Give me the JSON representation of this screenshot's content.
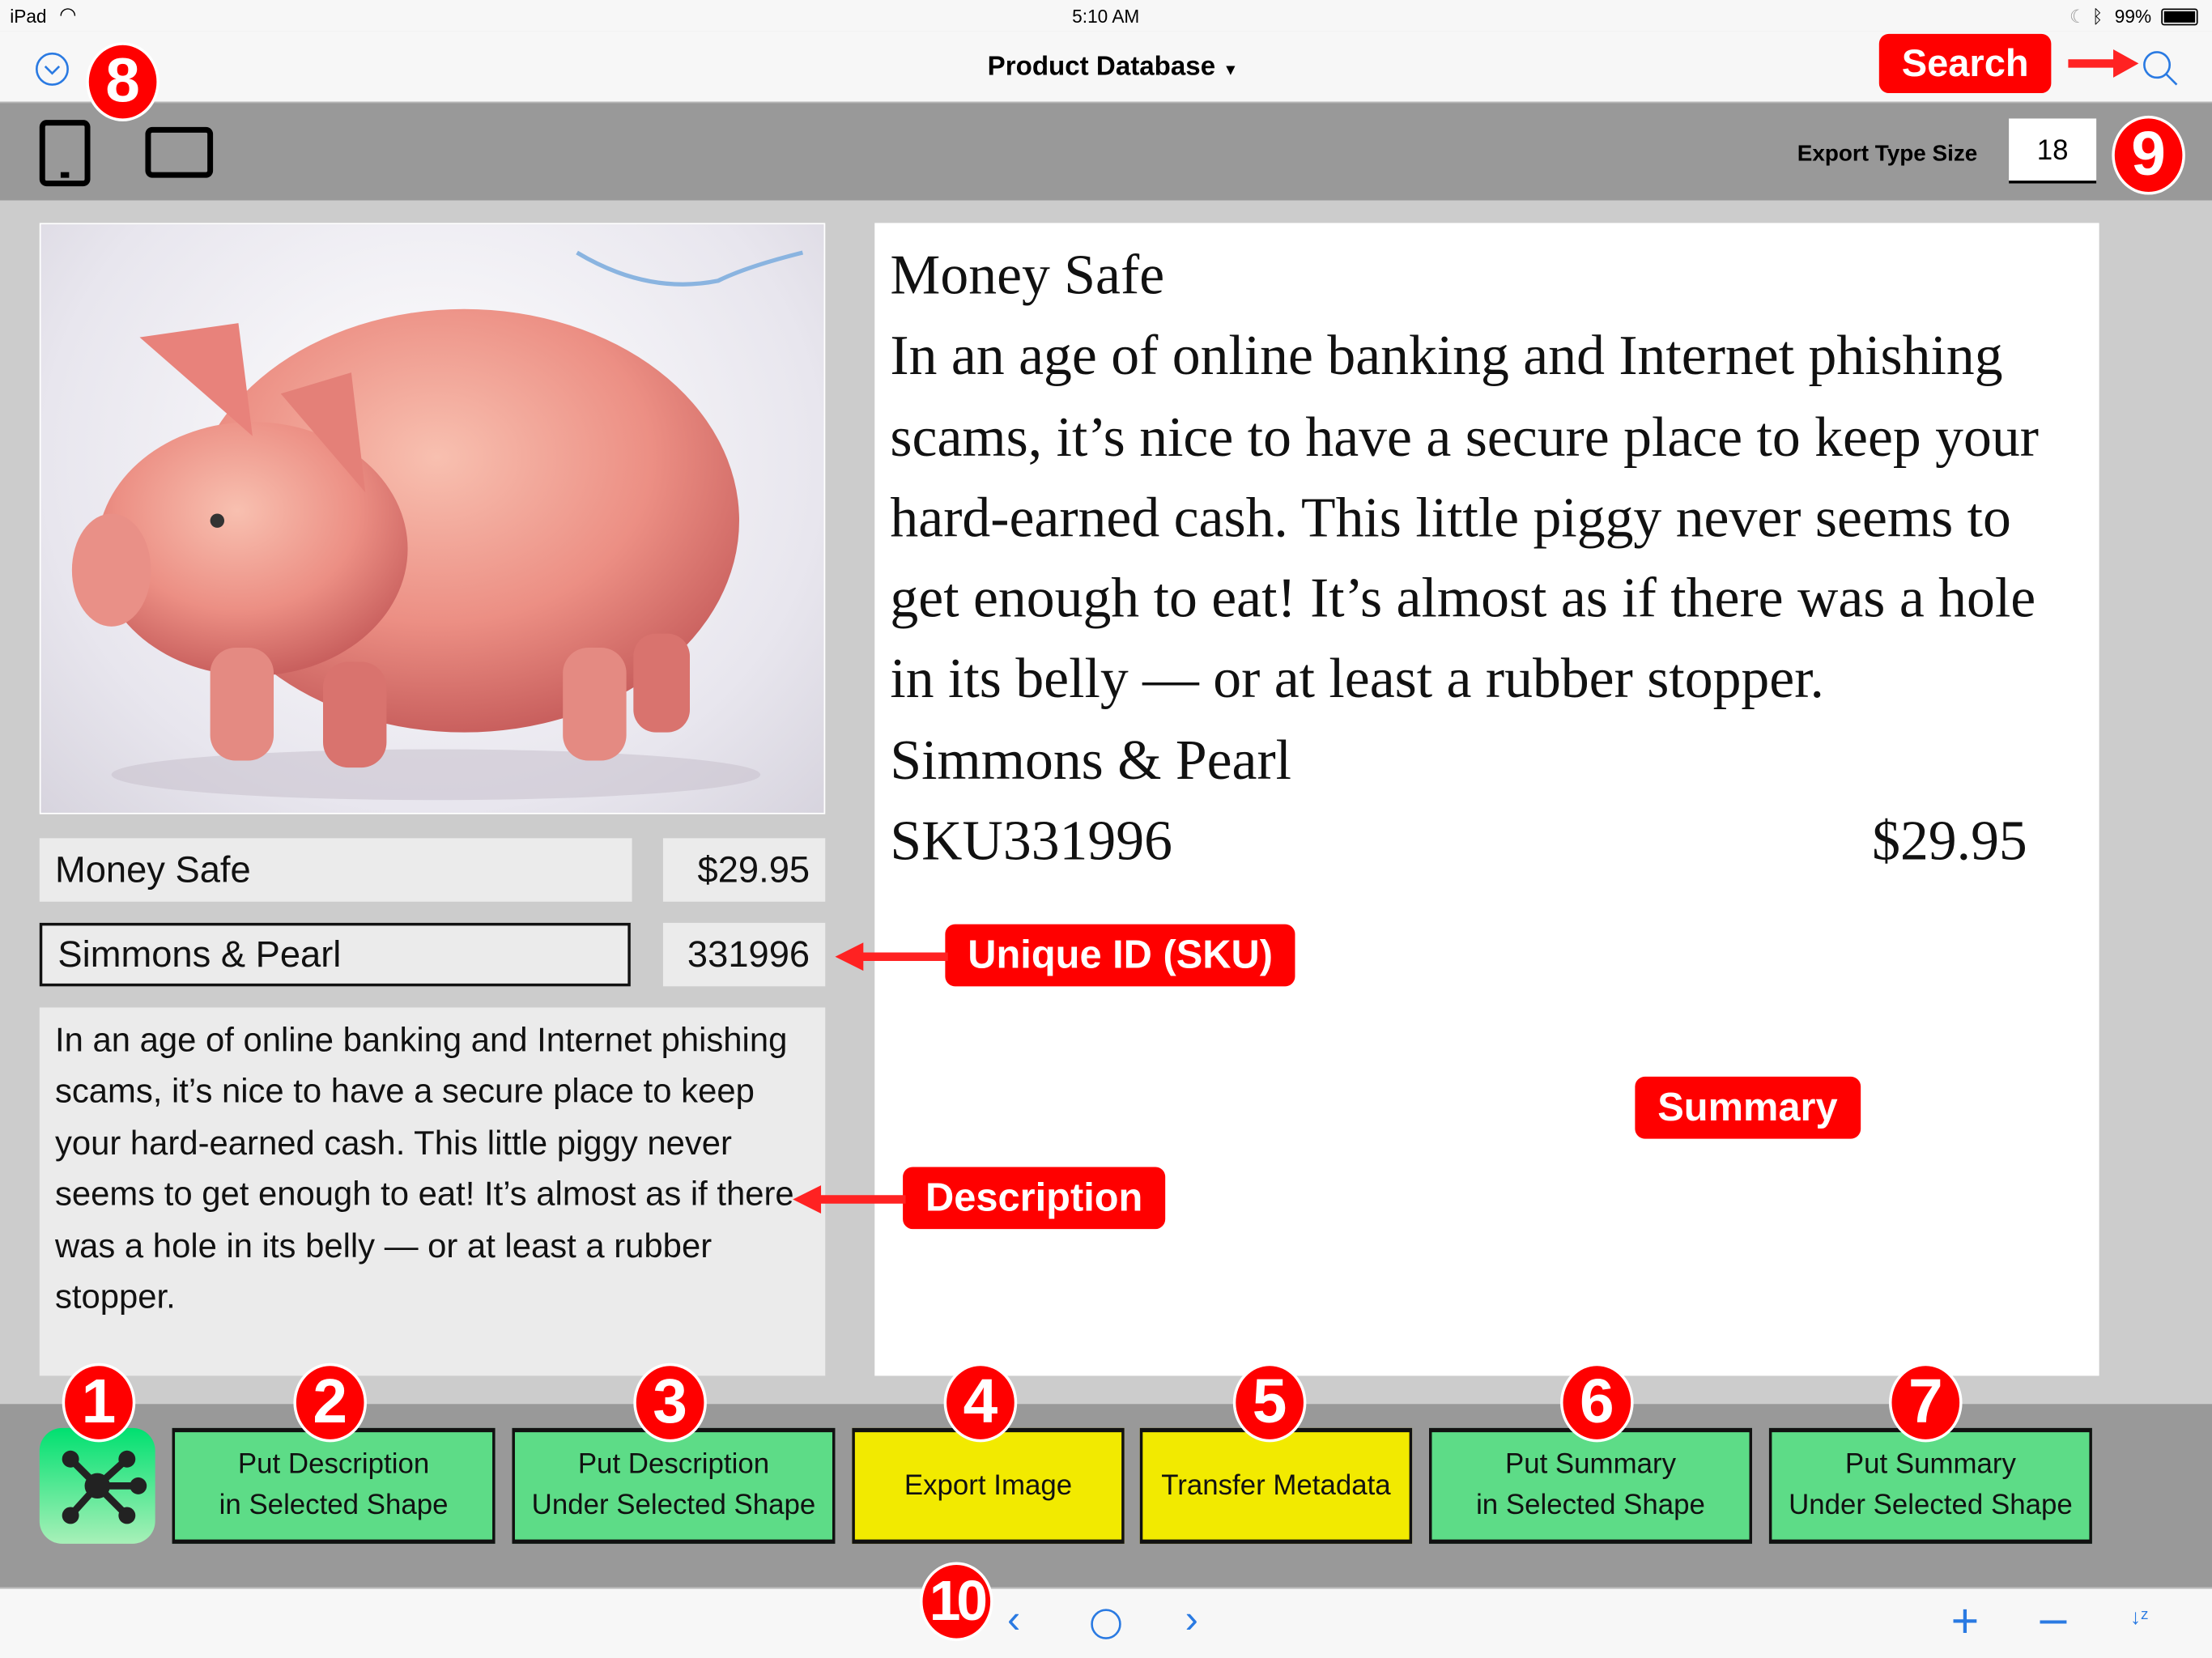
{
  "status": {
    "device": "iPad",
    "time": "5:10 AM",
    "battery": "99%"
  },
  "nav": {
    "title": "Product Database",
    "left_icon": "chevron-circle-down-icon",
    "right_icon": "search-icon"
  },
  "toolbar": {
    "export_type_size_label": "Export Type Size",
    "export_type_size_value": "18"
  },
  "record": {
    "name": "Money Safe",
    "price": "$29.95",
    "manufacturer": "Simmons & Pearl",
    "sku": "331996",
    "description": "In an age of online banking and Internet phishing scams, it’s nice to have a secure place to keep your hard-earned cash. This little piggy never seems to get enough to eat! It’s almost as if there was a hole in its belly — or at least a rubber stopper."
  },
  "summary": {
    "title": "Money Safe",
    "description": "In an age of online banking and Internet phishing scams, it’s nice to have a secure place to keep your hard-earned cash. This little piggy never seems to get enough to eat! It’s almost as if there was a hole in its belly — or at least a rubber stopper.",
    "manufacturer": "Simmons & Pearl",
    "sku": "SKU331996",
    "price": "$29.95"
  },
  "buttons": [
    {
      "label": "Put Description\nin Selected Shape"
    },
    {
      "label": "Put Description\nUnder Selected Shape"
    },
    {
      "label": "Export Image"
    },
    {
      "label": "Transfer Metadata"
    },
    {
      "label": "Put Summary\nin Selected Shape"
    },
    {
      "label": "Put Summary\nUnder Selected Shape"
    }
  ],
  "annotations": {
    "search": "Search",
    "sku": "Unique ID (SKU)",
    "description": "Description",
    "summary": "Summary",
    "badges": [
      "1",
      "2",
      "3",
      "4",
      "5",
      "6",
      "7",
      "8",
      "9",
      "10"
    ]
  },
  "colors": {
    "annotation_red": "#ff0000",
    "button_green": "#5ddc87",
    "button_yellow": "#f2ea00",
    "ios_blue": "#2a7ae2"
  }
}
